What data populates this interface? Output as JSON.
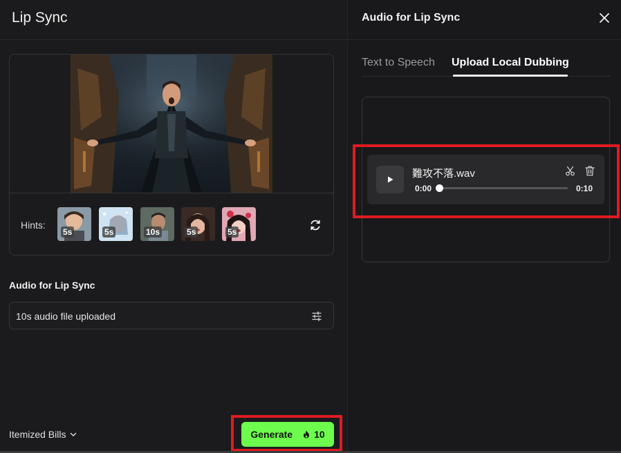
{
  "left": {
    "title": "Lip Sync",
    "hints_label": "Hints:",
    "hints": [
      {
        "duration": "5s",
        "icon": "animated-boy-thumbnail"
      },
      {
        "duration": "5s",
        "icon": "girl-snow-thumbnail"
      },
      {
        "duration": "10s",
        "icon": "man-portrait-thumbnail"
      },
      {
        "duration": "5s",
        "icon": "woman-portrait-thumbnail"
      },
      {
        "duration": "5s",
        "icon": "woman-roses-thumbnail"
      }
    ],
    "audio_heading": "Audio for Lip Sync",
    "audio_field_value": "10s audio file uploaded",
    "bills_label": "Itemized Bills",
    "generate": {
      "label": "Generate",
      "cost": "10"
    }
  },
  "right": {
    "title": "Audio for Lip Sync",
    "tabs": [
      {
        "label": "Text to Speech",
        "active": false
      },
      {
        "label": "Upload Local Dubbing",
        "active": true
      }
    ],
    "audio_item": {
      "file_name": "難攻不落.wav",
      "current_time": "0:00",
      "duration": "0:10",
      "progress": 0
    }
  },
  "colors": {
    "accent_green": "#6dfc4d",
    "highlight_red": "#e01b22",
    "background": "#1a1a1c"
  }
}
